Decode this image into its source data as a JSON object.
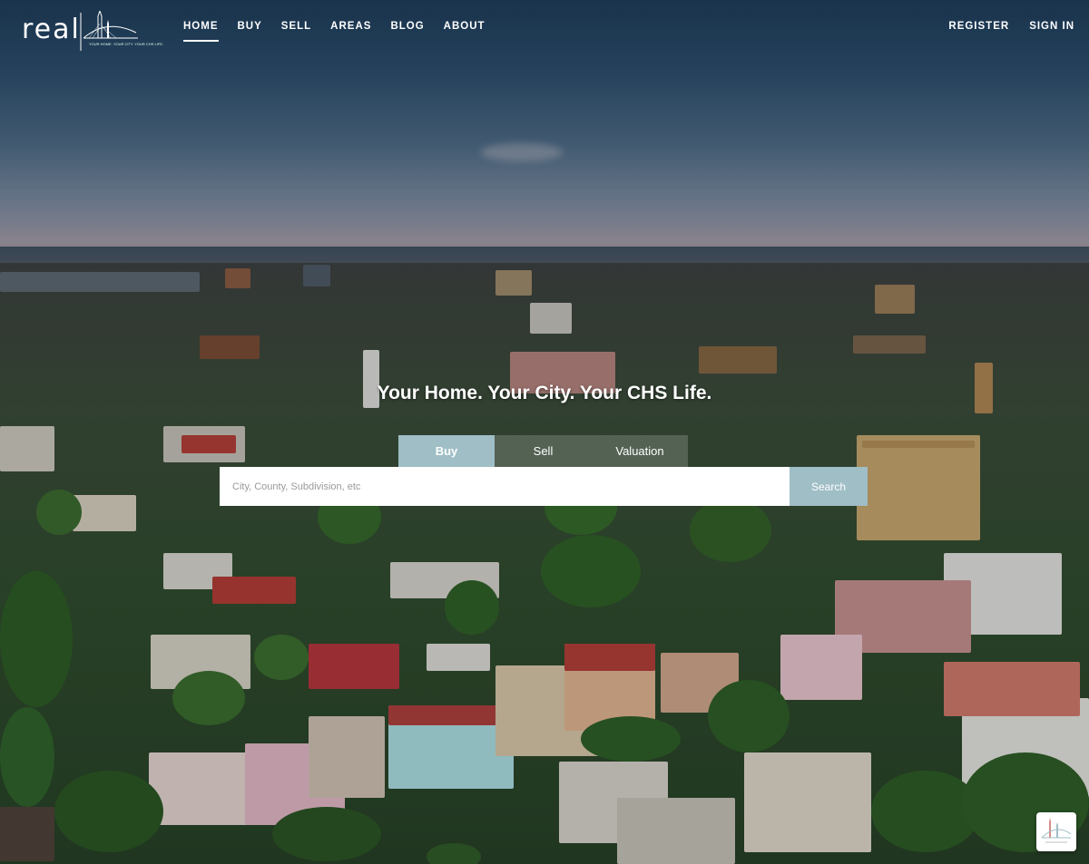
{
  "header": {
    "logo": {
      "text": "real",
      "tagline": "YOUR HOME. YOUR CITY. YOUR CHS LIFE."
    },
    "nav": [
      {
        "label": "HOME",
        "active": true
      },
      {
        "label": "BUY",
        "active": false
      },
      {
        "label": "SELL",
        "active": false
      },
      {
        "label": "AREAS",
        "active": false
      },
      {
        "label": "BLOG",
        "active": false
      },
      {
        "label": "ABOUT",
        "active": false
      }
    ],
    "auth": {
      "register_label": "REGISTER",
      "signin_label": "SIGN IN"
    }
  },
  "hero": {
    "headline": "Your Home. Your City. Your CHS Life.",
    "tabs": [
      {
        "label": "Buy",
        "active": true
      },
      {
        "label": "Sell",
        "active": false
      },
      {
        "label": "Valuation",
        "active": false
      }
    ],
    "search": {
      "placeholder": "City, County, Subdivision, etc",
      "button_label": "Search"
    }
  },
  "colors": {
    "accent": "#9fbec6",
    "text": "#ffffff"
  },
  "icons": {
    "logo": "bridge-steeple-logo-icon",
    "badge": "site-badge-icon"
  }
}
